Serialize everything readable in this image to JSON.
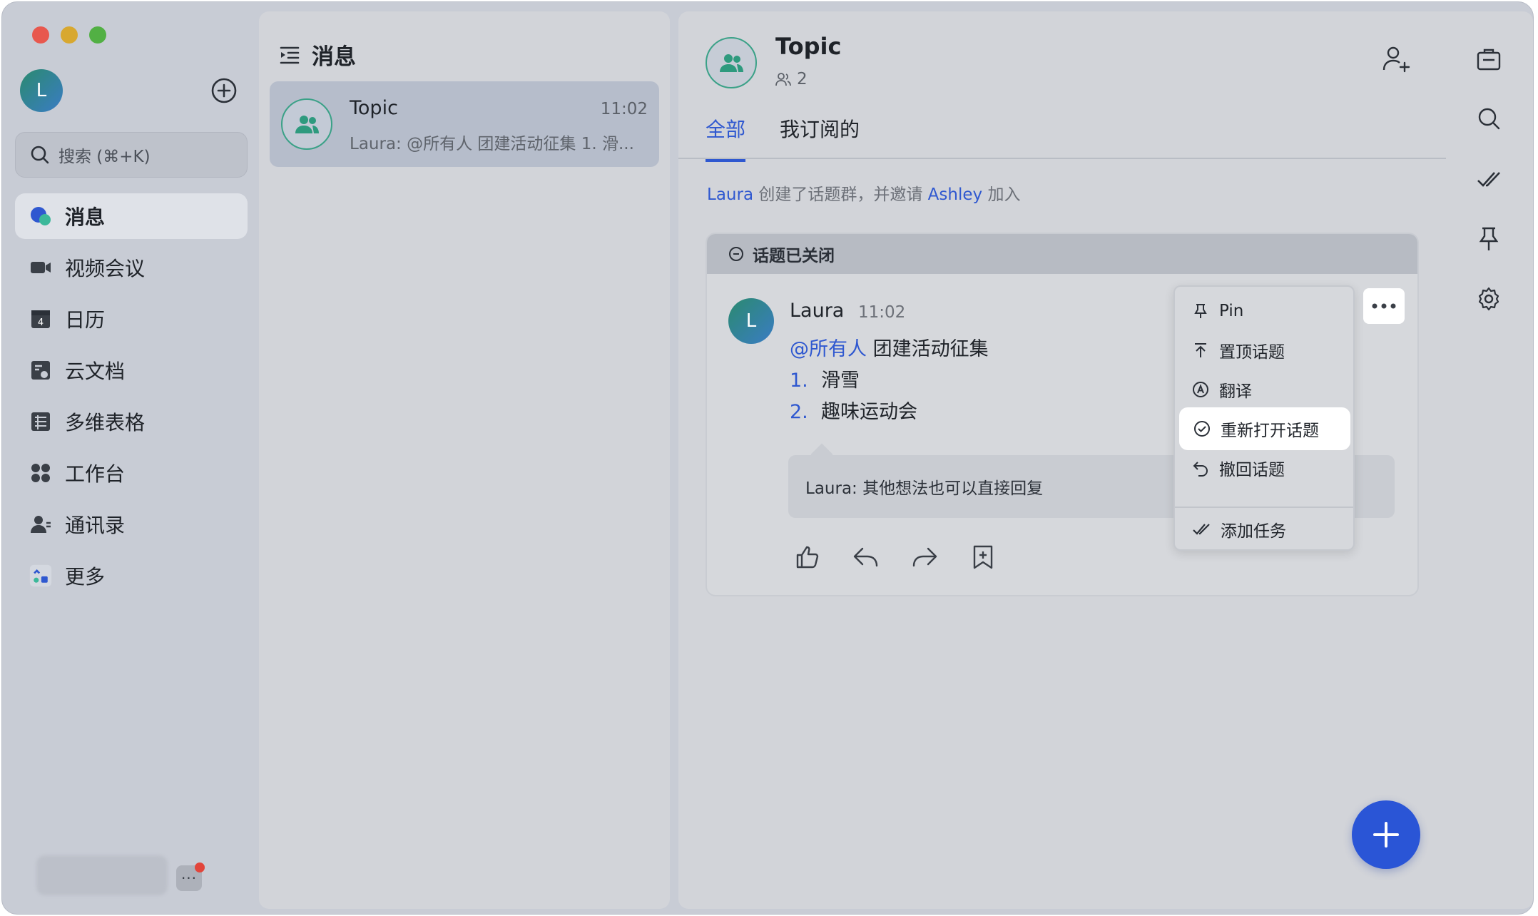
{
  "sidebar": {
    "user_initial": "L",
    "search_placeholder": "搜索 (⌘+K)",
    "items": [
      {
        "label": "消息",
        "icon": "message-bubble-icon"
      },
      {
        "label": "视频会议",
        "icon": "video-camera-icon"
      },
      {
        "label": "日历",
        "icon": "calendar-icon",
        "calendar_day": "4"
      },
      {
        "label": "云文档",
        "icon": "cloud-doc-icon"
      },
      {
        "label": "多维表格",
        "icon": "base-table-icon"
      },
      {
        "label": "工作台",
        "icon": "workplace-grid-icon"
      },
      {
        "label": "通讯录",
        "icon": "contacts-icon"
      },
      {
        "label": "更多",
        "icon": "more-apps-icon"
      }
    ],
    "bottom_more": "···"
  },
  "conversations": {
    "header": "消息",
    "items": [
      {
        "title": "Topic",
        "time": "11:02",
        "preview": "Laura: @所有人 团建活动征集 1. 滑..."
      }
    ]
  },
  "topic": {
    "title": "Topic",
    "member_count": "2",
    "tabs": [
      "全部",
      "我订阅的"
    ],
    "system_message": {
      "actor": "Laura",
      "middle": "创建了话题群，并邀请",
      "invitee": "Ashley",
      "tail": "加入"
    },
    "closed_label": "话题已关闭",
    "message": {
      "author_initial": "L",
      "author": "Laura",
      "time": "11:02",
      "mention": "@所有人",
      "headline": "团建活动征集",
      "list": [
        {
          "num": "1.",
          "text": "滑雪"
        },
        {
          "num": "2.",
          "text": "趣味运动会"
        }
      ],
      "reply": "Laura: 其他想法也可以直接回复"
    },
    "menu": [
      {
        "label": "Pin",
        "icon": "pin-icon"
      },
      {
        "label": "置顶话题",
        "icon": "pin-top-icon"
      },
      {
        "label": "翻译",
        "icon": "translate-icon"
      },
      {
        "label": "重新打开话题",
        "icon": "check-circle-icon",
        "highlighted": true
      },
      {
        "label": "撤回话题",
        "icon": "undo-icon"
      },
      {
        "label": "添加任务",
        "icon": "task-check-icon"
      }
    ]
  },
  "colors": {
    "accent": "#2f58d0",
    "fab": "#2a55d6",
    "group_ring": "#3aa187",
    "badge": "#e2453b"
  }
}
